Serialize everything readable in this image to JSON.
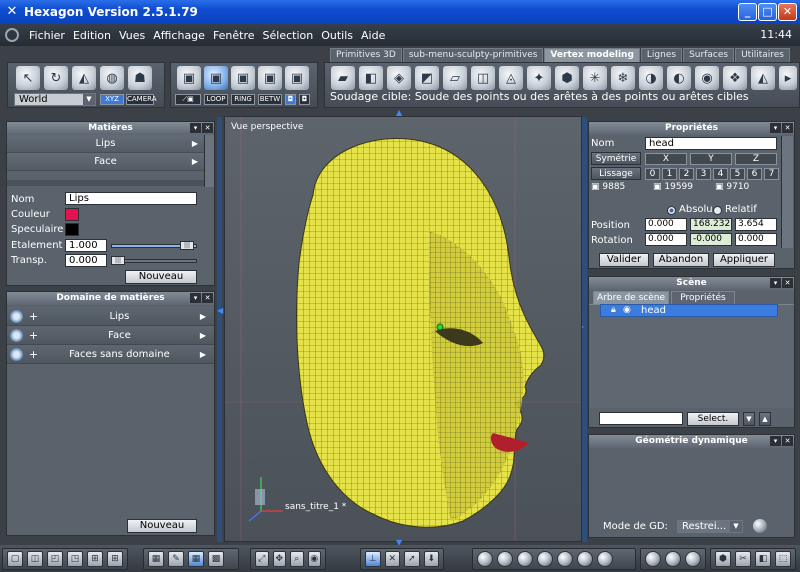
{
  "app": {
    "title": "Hexagon Version 2.5.1.79",
    "clock": "11:44",
    "colors": {
      "accent": "#3b7ce0",
      "mesh": "#e6e24a",
      "titlebar": "#0e4ccf"
    }
  },
  "menu": [
    "Fichier",
    "Edition",
    "Vues",
    "Affichage",
    "Fenêtre",
    "Sélection",
    "Outils",
    "Aide"
  ],
  "tabs": [
    {
      "label": "Primitives 3D",
      "active": false
    },
    {
      "label": "sub-menu-sculpty-primitives",
      "active": false
    },
    {
      "label": "Vertex modeling",
      "active": true
    },
    {
      "label": "Lignes",
      "active": false
    },
    {
      "label": "Surfaces",
      "active": false
    },
    {
      "label": "Utilitaires",
      "active": false
    }
  ],
  "toolbar_left": {
    "space_label": "World",
    "xyz": "XYZ",
    "camera": "CAMERA"
  },
  "toolbar_select": {
    "loop": "LOOP",
    "ring": "RING",
    "betw": "BETW"
  },
  "hint": "Soudage cible: Soude des points ou des arêtes à des points ou arêtes cibles",
  "matieres": {
    "title": "Matières",
    "items": [
      "Lips",
      "Face"
    ],
    "nom_label": "Nom",
    "nom_value": "Lips",
    "couleur_label": "Couleur",
    "couleur_value": "#e4124e",
    "speculaire_label": "Speculaire",
    "speculaire_value": "#000000",
    "etalement_label": "Etalement",
    "etalement_value": "1.000",
    "transp_label": "Transp.",
    "transp_value": "0.000",
    "nouveau": "Nouveau"
  },
  "domaine": {
    "title": "Domaine de matières",
    "items": [
      "Lips",
      "Face",
      "Faces sans domaine"
    ],
    "nouveau": "Nouveau"
  },
  "viewport": {
    "title": "Vue perspective",
    "model_name": "sans_titre_1 *"
  },
  "proprietes": {
    "title": "Propriétés",
    "nom_label": "Nom",
    "nom_value": "head",
    "symetrie": "Symétrie",
    "axes": [
      "X",
      "Y",
      "Z"
    ],
    "lissage": "Lissage",
    "levels": [
      "0",
      "1",
      "2",
      "3",
      "4",
      "5",
      "6",
      "7"
    ],
    "counts": [
      "9885",
      "19599",
      "9710"
    ],
    "absolu": "Absolu",
    "relatif": "Relatif",
    "position_label": "Position",
    "position": [
      "0.000",
      "168.232",
      "3.654"
    ],
    "rotation_label": "Rotation",
    "rotation": [
      "0.000",
      "-0.000",
      "0.000"
    ],
    "valider": "Valider",
    "abandon": "Abandon",
    "appliquer": "Appliquer"
  },
  "scene": {
    "title": "Scène",
    "tab_tree": "Arbre de scène",
    "tab_props": "Propriétés",
    "item": "head",
    "select_button": "Select."
  },
  "geometrie": {
    "title": "Géométrie dynamique",
    "mode_label": "Mode de GD:",
    "mode_value": "Restrei..."
  }
}
